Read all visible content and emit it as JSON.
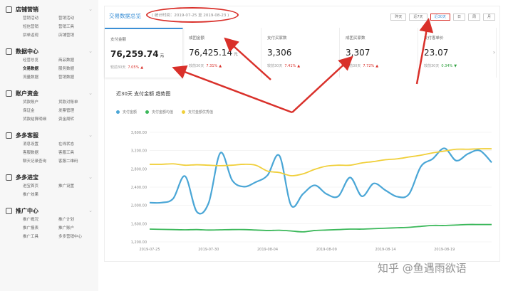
{
  "sidebar": {
    "sections": [
      {
        "title": "店铺营销",
        "items": [
          "营销活动",
          "营销活动",
          "短信营销",
          "营销工具",
          "拼单返现",
          "店铺营销"
        ]
      },
      {
        "title": "数据中心",
        "items": [
          "经营总览",
          "商品数据",
          "交易数据",
          "服务数据",
          "流量数据",
          "营销数据"
        ],
        "active": 2
      },
      {
        "title": "账户资金",
        "items": [
          "货款账户",
          "货款对账单",
          "保证金",
          "发票管理",
          "货款结算明细",
          "资金周转"
        ]
      },
      {
        "title": "多多客服",
        "items": [
          "消息设置",
          "在线状态",
          "客服数据",
          "客服工具",
          "聊天记录查询",
          "客服二维码"
        ]
      },
      {
        "title": "多多进宝",
        "items": [
          "进宝首页",
          "推广设置",
          "推广效果"
        ]
      },
      {
        "title": "推广中心",
        "items": [
          "推广概况",
          "推广计划",
          "推广报表",
          "推广账户",
          "推广工具",
          "多多营销中心"
        ]
      }
    ]
  },
  "header": {
    "title": "交易数据总览",
    "stat_time": "( 统计时间：2019-07-25 至 2019-08-23 )",
    "range_buttons": [
      "昨天",
      "近7天",
      "近30天",
      "日",
      "周",
      "月"
    ],
    "active_range": 2
  },
  "kpis": [
    {
      "label": "支付金额",
      "value": "76,259.74",
      "unit": "元",
      "compare": "较前30天",
      "pct": "7.05%",
      "dir": "up"
    },
    {
      "label": "成团金额",
      "value": "76,425.14",
      "unit": "元",
      "compare": "较前30天",
      "pct": "7.31%",
      "dir": "up"
    },
    {
      "label": "支付买家数",
      "value": "3,306",
      "unit": "",
      "compare": "较前30天",
      "pct": "7.41%",
      "dir": "up"
    },
    {
      "label": "成团买家数",
      "value": "3,307",
      "unit": "",
      "compare": "较前30天",
      "pct": "7.72%",
      "dir": "up"
    },
    {
      "label": "支付客单价",
      "value": "23.07",
      "unit": "",
      "compare": "较前30天",
      "pct": "0.34%",
      "dir": "down"
    }
  ],
  "trend_title": "近30天 支付金额 趋势图",
  "colors": {
    "accent": "#3a8fd6",
    "annotation_red": "#d9302a",
    "series_blue": "#4aa6d6",
    "series_green": "#3bb85a",
    "series_yellow": "#f0cf3a"
  },
  "chart_data": {
    "type": "line",
    "ylim": [
      1200,
      3600
    ],
    "yticks": [
      "3,600.00",
      "3,200.00",
      "2,800.00",
      "2,400.00",
      "2,000.00",
      "1,600.00",
      "1,200.00"
    ],
    "xticks": [
      "2019-07-25",
      "2019-07-30",
      "2019-08-04",
      "2019-08-09",
      "2019-08-14",
      "2019-08-19"
    ],
    "x": [
      "07-25",
      "07-26",
      "07-27",
      "07-28",
      "07-29",
      "07-30",
      "07-31",
      "08-01",
      "08-02",
      "08-03",
      "08-04",
      "08-05",
      "08-06",
      "08-07",
      "08-08",
      "08-09",
      "08-10",
      "08-11",
      "08-12",
      "08-13",
      "08-14",
      "08-15",
      "08-16",
      "08-17",
      "08-18",
      "08-19",
      "08-20",
      "08-21",
      "08-22",
      "08-23"
    ],
    "series": [
      {
        "name": "支付金额",
        "color": "#4aa6d6",
        "values": [
          2060,
          2060,
          2150,
          2640,
          1860,
          2050,
          3150,
          2550,
          2410,
          2510,
          2660,
          3090,
          2000,
          2250,
          2440,
          2250,
          2200,
          2610,
          2200,
          2480,
          2330,
          2190,
          2250,
          2850,
          3020,
          3250,
          2980,
          3130,
          3200,
          2940
        ]
      },
      {
        "name": "支付金额均值",
        "color": "#3bb85a",
        "values": [
          1480,
          1475,
          1470,
          1465,
          1470,
          1460,
          1465,
          1470,
          1470,
          1460,
          1450,
          1455,
          1440,
          1420,
          1450,
          1460,
          1470,
          1480,
          1480,
          1490,
          1500,
          1510,
          1520,
          1540,
          1560,
          1560,
          1570,
          1580,
          1580,
          1580
        ]
      },
      {
        "name": "支付金额优秀值",
        "color": "#f0cf3a",
        "values": [
          2900,
          2900,
          2910,
          2880,
          2890,
          2880,
          2870,
          2880,
          2900,
          2880,
          2750,
          2720,
          2650,
          2690,
          2790,
          2860,
          2880,
          2880,
          2930,
          2960,
          3000,
          3020,
          3060,
          3100,
          3150,
          3190,
          3230,
          3230,
          3240,
          3240
        ]
      }
    ]
  },
  "watermark": "知乎 @鱼遇雨欲语"
}
